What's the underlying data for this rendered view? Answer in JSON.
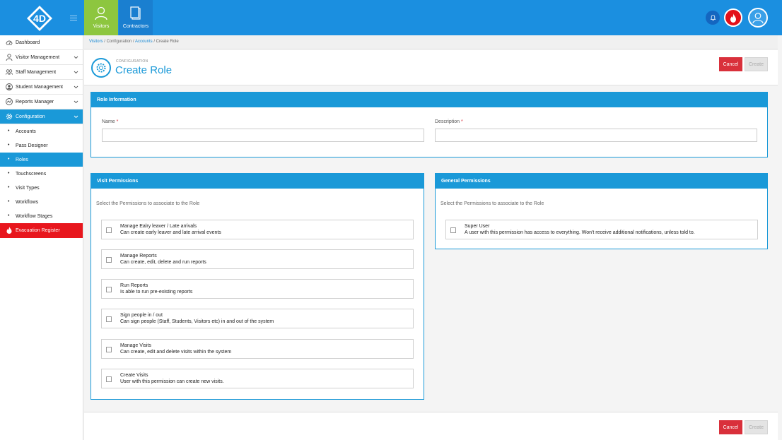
{
  "topbar": {
    "tabs": [
      {
        "label": "Visitors",
        "icon": "person-icon"
      },
      {
        "label": "Contractors",
        "icon": "document-icon"
      }
    ]
  },
  "sidebar": {
    "items": [
      {
        "label": "Dashboard",
        "icon": "gauge-icon"
      },
      {
        "label": "Visitor Management",
        "icon": "person-icon"
      },
      {
        "label": "Staff Management",
        "icon": "staff-icon"
      },
      {
        "label": "Student Management",
        "icon": "student-icon"
      },
      {
        "label": "Reports Manager",
        "icon": "chart-icon"
      },
      {
        "label": "Configuration",
        "icon": "gear-icon"
      }
    ],
    "sub_items": [
      "Accounts",
      "Pass Designer",
      "Roles",
      "Touchscreens",
      "Visit Types",
      "Workflows",
      "Workflow Stages"
    ],
    "evacuation": "Evacuation Register"
  },
  "breadcrumb": {
    "items": [
      "Visitors",
      "Configuration",
      "Accounts",
      "Create Role"
    ],
    "sep": "/"
  },
  "header": {
    "pre_title": "CONFIGURATION",
    "title": "Create Role",
    "cancel": "Cancel",
    "create": "Create"
  },
  "role_info": {
    "heading": "Role Information",
    "name_label": "Name",
    "description_label": "Description",
    "required_mark": "*",
    "name_value": "",
    "description_value": ""
  },
  "visit_permissions": {
    "heading": "Visit Permissions",
    "hint": "Select the Permissions to associate to the Role",
    "items": [
      {
        "title": "Manage Ealry leaver / Late arrivals",
        "desc": "Can create early leaver and late arrival events"
      },
      {
        "title": "Manage Reports",
        "desc": "Can create, edit, delete and run reports"
      },
      {
        "title": "Run Reports",
        "desc": "Is able to run pre-existing reports"
      },
      {
        "title": "Sign people in / out",
        "desc": "Can sign people (Staff, Students, Visitors etc) in and out of the system"
      },
      {
        "title": "Manage Visits",
        "desc": "Can create, edit and delete visits within the system"
      },
      {
        "title": "Create Visits",
        "desc": "User with this permission can create new visits."
      }
    ]
  },
  "general_permissions": {
    "heading": "General Permissions",
    "hint": "Select the Permissions to associate to the Role",
    "items": [
      {
        "title": "Super User",
        "desc": "A user with this permission has access to everything. Won't receive additional notifications, unless told to."
      }
    ]
  },
  "footer": {
    "cancel": "Cancel",
    "create": "Create"
  },
  "colors": {
    "accent": "#1a99d8",
    "topbar": "#1b8fe0",
    "visitors_tab": "#8dc63f",
    "cancel": "#d9303b",
    "evac": "#e8161d"
  }
}
